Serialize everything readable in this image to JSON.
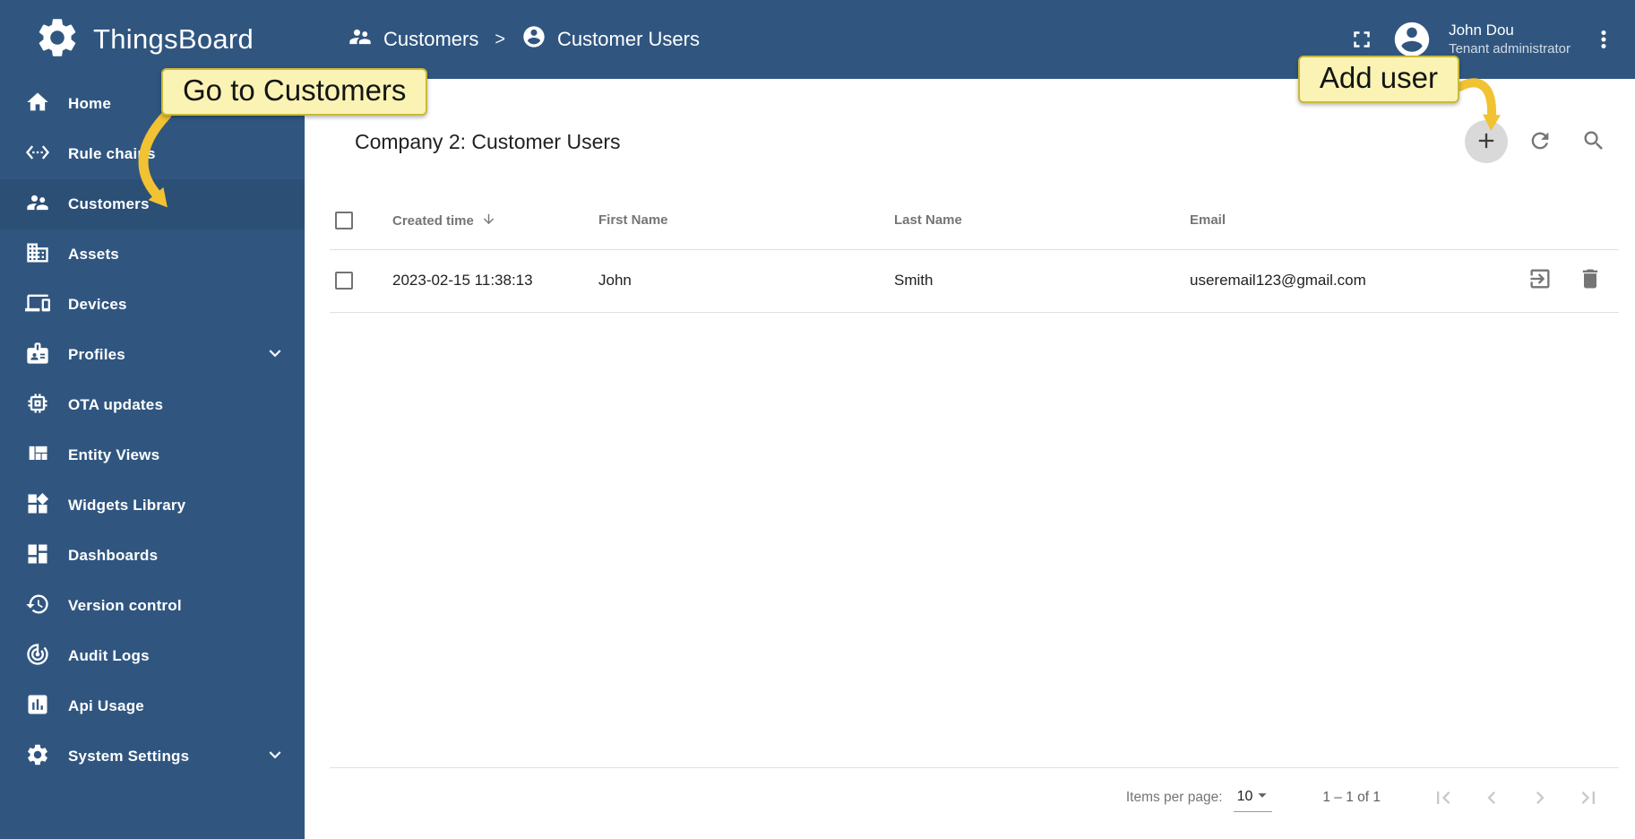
{
  "brand": {
    "name": "ThingsBoard"
  },
  "sidebar": {
    "items": [
      {
        "label": "Home"
      },
      {
        "label": "Rule chains"
      },
      {
        "label": "Customers"
      },
      {
        "label": "Assets"
      },
      {
        "label": "Devices"
      },
      {
        "label": "Profiles",
        "expandable": true
      },
      {
        "label": "OTA updates"
      },
      {
        "label": "Entity Views"
      },
      {
        "label": "Widgets Library"
      },
      {
        "label": "Dashboards"
      },
      {
        "label": "Version control"
      },
      {
        "label": "Audit Logs"
      },
      {
        "label": "Api Usage"
      },
      {
        "label": "System Settings",
        "expandable": true
      }
    ]
  },
  "header": {
    "breadcrumb_items": [
      {
        "label": "Customers"
      },
      {
        "label": "Customer Users"
      }
    ],
    "separator": ">",
    "user": {
      "name": "John Dou",
      "role": "Tenant administrator"
    }
  },
  "content": {
    "title": "Company 2: Customer Users",
    "table": {
      "columns": [
        "Created time",
        "First Name",
        "Last Name",
        "Email"
      ],
      "rows": [
        {
          "created_time": "2023-02-15 11:38:13",
          "first_name": "John",
          "last_name": "Smith",
          "email": "useremail123@gmail.com"
        }
      ]
    },
    "paginator": {
      "items_per_page_label": "Items per page:",
      "items_per_page_value": "10",
      "range": "1 – 1 of 1"
    }
  },
  "annotations": {
    "go_to_customers": "Go to Customers",
    "add_user": "Add user"
  },
  "colors": {
    "primary": "#305680",
    "tooltip_bg": "#faf3b4",
    "tooltip_border": "#c9ba3b",
    "arrow": "#f1c232",
    "hotspot_bg": "#d9d9d9",
    "table_border": "#e0e0e0"
  }
}
